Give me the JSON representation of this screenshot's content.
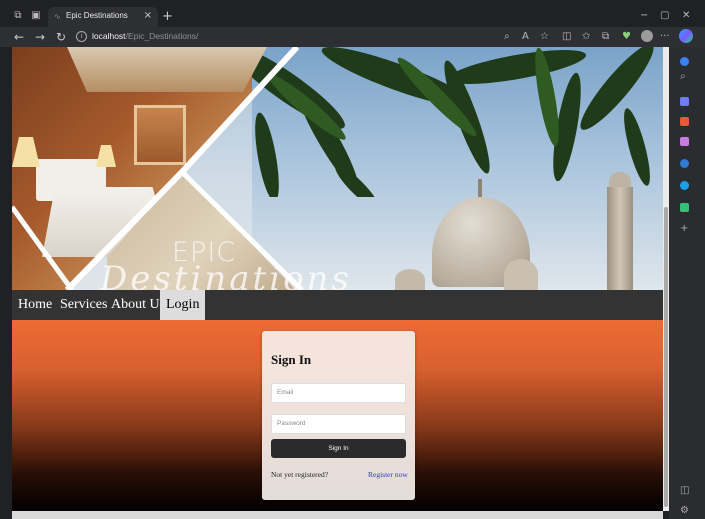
{
  "browser": {
    "tab_title": "Epic Destinations",
    "tab_close": "×",
    "new_tab": "+",
    "url_host": "localhost",
    "url_path": "/Epic_Destinations/",
    "back": "←",
    "forward": "→",
    "reload": "↻",
    "minimize": "−",
    "maximize": "▢",
    "close": "✕",
    "more": "···"
  },
  "hero": {
    "title": "EPIC",
    "script": "Destinations"
  },
  "nav": {
    "items": [
      {
        "label": "Home"
      },
      {
        "label": "Services"
      },
      {
        "label": "About Us"
      },
      {
        "label": "Login"
      }
    ],
    "active": "Login"
  },
  "signin": {
    "heading": "Sign In",
    "email_placeholder": "Email",
    "password_placeholder": "Password",
    "button": "Sign In",
    "prompt": "Not yet registered?",
    "register_link": "Register now"
  },
  "colors": {
    "accent_orange": "#ee6a35",
    "nav_bg": "#333333",
    "link_blue": "#2a36e0"
  }
}
